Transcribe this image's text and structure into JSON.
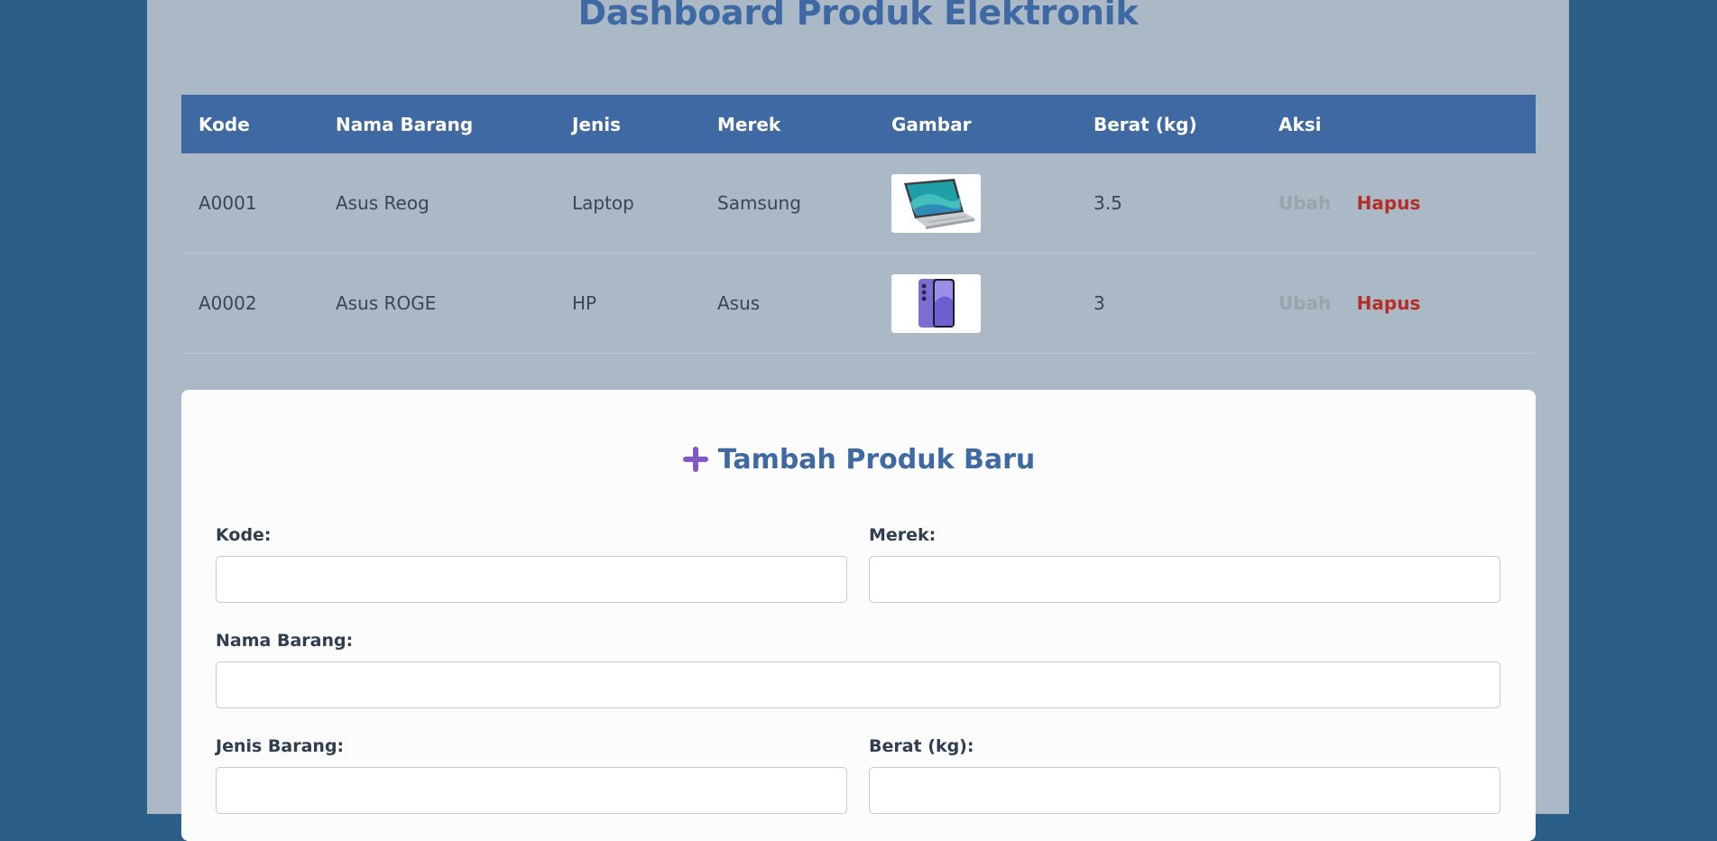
{
  "page": {
    "title": "Dashboard Produk Elektronik"
  },
  "table": {
    "headers": {
      "kode": "Kode",
      "nama": "Nama Barang",
      "jenis": "Jenis",
      "merek": "Merek",
      "gambar": "Gambar",
      "berat": "Berat (kg)",
      "aksi": "Aksi"
    },
    "rows": [
      {
        "kode": "A0001",
        "nama": "Asus Reog",
        "jenis": "Laptop",
        "merek": "Samsung",
        "gambar_icon": "laptop-image",
        "berat": "3.5",
        "ubah": "Ubah",
        "hapus": "Hapus"
      },
      {
        "kode": "A0002",
        "nama": "Asus ROGE",
        "jenis": "HP",
        "merek": "Asus",
        "gambar_icon": "smartphone-image",
        "berat": "3",
        "ubah": "Ubah",
        "hapus": "Hapus"
      }
    ]
  },
  "form": {
    "title": "Tambah Produk Baru",
    "icon": "plus-icon",
    "kode_label": "Kode:",
    "kode_value": "",
    "merek_label": "Merek:",
    "merek_value": "",
    "nama_label": "Nama Barang:",
    "nama_value": "",
    "jenis_label": "Jenis Barang:",
    "jenis_value": "",
    "berat_label": "Berat (kg):",
    "berat_value": ""
  },
  "colors": {
    "background": "#2b5f87",
    "panel": "#abb8c6",
    "accent": "#3e69a2",
    "danger": "#b52f26",
    "muted": "#9ba3ad",
    "plus_icon": "#8158c4"
  }
}
